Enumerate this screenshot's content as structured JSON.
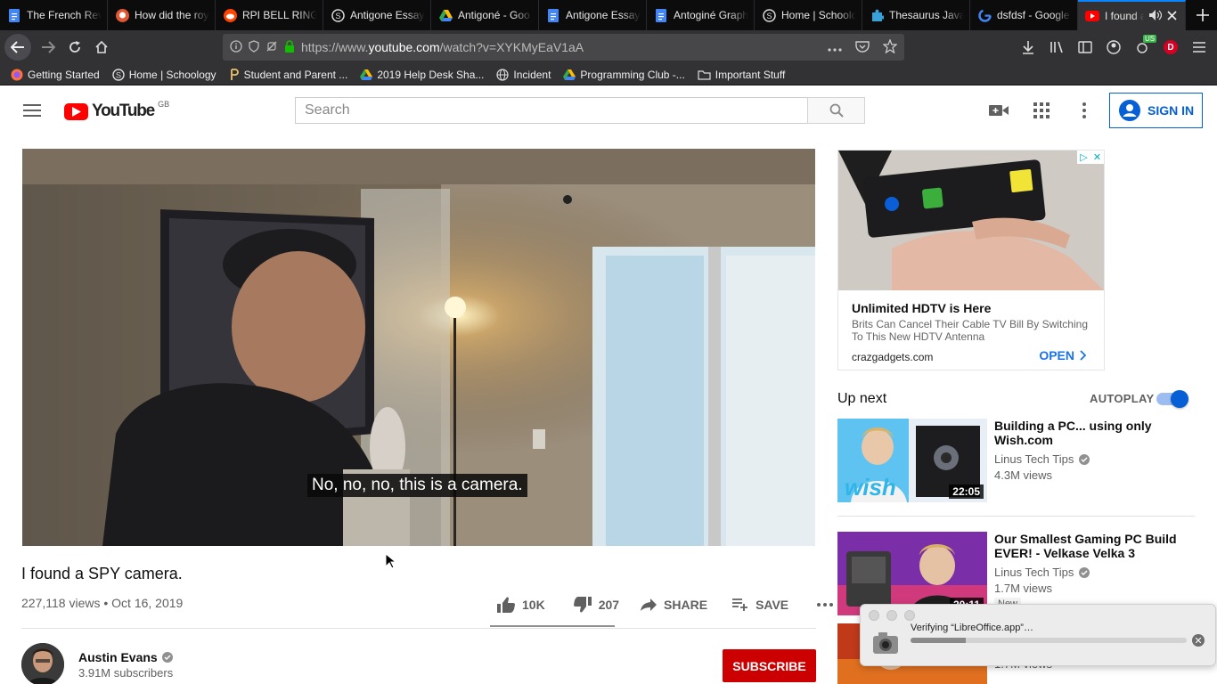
{
  "browser": {
    "tabs": [
      {
        "label": "The French Rev",
        "icon": "docs-icon"
      },
      {
        "label": "How did the roy",
        "icon": "duckduckgo-icon"
      },
      {
        "label": "RPI BELL RINGE",
        "icon": "reddit-icon"
      },
      {
        "label": "Antigone Essay",
        "icon": "schoology-icon"
      },
      {
        "label": "Antigoné - Goo",
        "icon": "drive-icon"
      },
      {
        "label": "Antigone Essay",
        "icon": "docs-icon"
      },
      {
        "label": "Antoginé Graph",
        "icon": "docs-icon"
      },
      {
        "label": "Home | Schoolo",
        "icon": "schoology-icon"
      },
      {
        "label": "Thesaurus Java",
        "icon": "puzzle-icon"
      },
      {
        "label": "dsfdsf - Google",
        "icon": "google-icon"
      },
      {
        "label": "I found a SPY",
        "icon": "youtube-icon",
        "active": true
      }
    ],
    "url": {
      "prefix": "https://www.",
      "domain": "youtube.com",
      "path": "/watch?v=XYKMyEaV1aA"
    },
    "extension_badge": "US",
    "profile_initial": "D",
    "bookmarks": [
      {
        "label": "Getting Started",
        "icon": "firefox-icon"
      },
      {
        "label": "Home | Schoology",
        "icon": "schoology-icon"
      },
      {
        "label": "Student and Parent ...",
        "icon": "p-icon"
      },
      {
        "label": "2019 Help Desk Sha...",
        "icon": "drive-icon"
      },
      {
        "label": "Incident",
        "icon": "globe-icon"
      },
      {
        "label": "Programming Club -...",
        "icon": "drive-icon"
      },
      {
        "label": "Important Stuff",
        "icon": "folder-icon"
      }
    ]
  },
  "youtube": {
    "logo_text": "YouTube",
    "region": "GB",
    "search_placeholder": "Search",
    "sign_in": "SIGN IN",
    "video": {
      "caption": "No, no, no, this is a camera.",
      "title": "I found a SPY camera.",
      "meta": "227,118 views • Oct 16, 2019",
      "likes": "10K",
      "dislikes": "207",
      "share": "SHARE",
      "save": "SAVE"
    },
    "channel": {
      "name": "Austin Evans",
      "subscribers": "3.91M subscribers",
      "subscribe": "SUBSCRIBE"
    },
    "ad": {
      "title": "Unlimited HDTV is Here",
      "description": "Brits Can Cancel Their Cable TV Bill By Switching To This New HDTV Antenna",
      "domain": "crazgadgets.com",
      "cta": "OPEN"
    },
    "up_next": {
      "heading": "Up next",
      "autoplay": "AUTOPLAY",
      "autoplay_on": true,
      "items": [
        {
          "title": "Building a PC... using only Wish.com",
          "channel": "Linus Tech Tips",
          "views": "4.3M views",
          "duration": "22:05"
        },
        {
          "title": "Our Smallest Gaming PC Build EVER! - Velkase Velka 3",
          "channel": "Linus Tech Tips",
          "views": "1.7M views",
          "duration": "20:11",
          "badge": "New"
        },
        {
          "views": "1.7M views"
        }
      ]
    }
  },
  "notification": {
    "text": "Verifying “LibreOffice.app”…",
    "progress": 0.2
  },
  "colors": {
    "youtube_red": "#ff0000",
    "subscribe_red": "#cc0000",
    "link_blue": "#065fd4",
    "tab_accent": "#0a84ff"
  }
}
